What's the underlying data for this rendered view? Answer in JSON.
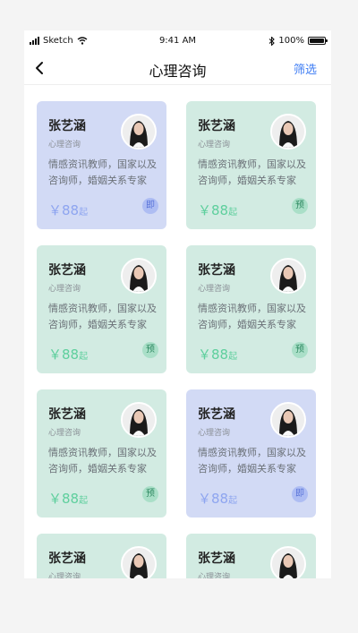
{
  "status_bar": {
    "carrier": "Sketch",
    "time": "9:41 AM",
    "battery": "100%",
    "battery_level": 1.0
  },
  "nav": {
    "title": "心理咨询",
    "filter_label": "筛选"
  },
  "cards": [
    {
      "name": "张艺涵",
      "role": "心理咨询",
      "desc": "情感资讯教师，国家以及咨询师，婚姻关系专家",
      "price": "￥88",
      "price_unit": "起",
      "badge": "即",
      "theme": "blue"
    },
    {
      "name": "张艺涵",
      "role": "心理咨询",
      "desc": "情感资讯教师，国家以及咨询师，婚姻关系专家",
      "price": "￥88",
      "price_unit": "起",
      "badge": "预",
      "theme": "teal"
    },
    {
      "name": "张艺涵",
      "role": "心理咨询",
      "desc": "情感资讯教师，国家以及咨询师，婚姻关系专家",
      "price": "￥88",
      "price_unit": "起",
      "badge": "预",
      "theme": "teal"
    },
    {
      "name": "张艺涵",
      "role": "心理咨询",
      "desc": "情感资讯教师，国家以及咨询师，婚姻关系专家",
      "price": "￥88",
      "price_unit": "起",
      "badge": "预",
      "theme": "teal"
    },
    {
      "name": "张艺涵",
      "role": "心理咨询",
      "desc": "情感资讯教师，国家以及咨询师，婚姻关系专家",
      "price": "￥88",
      "price_unit": "起",
      "badge": "预",
      "theme": "teal"
    },
    {
      "name": "张艺涵",
      "role": "心理咨询",
      "desc": "情感资讯教师，国家以及咨询师，婚姻关系专家",
      "price": "￥88",
      "price_unit": "起",
      "badge": "即",
      "theme": "blue"
    },
    {
      "name": "张艺涵",
      "role": "心理咨询",
      "desc": "",
      "price": "",
      "price_unit": "",
      "badge": "",
      "theme": "teal"
    },
    {
      "name": "张艺涵",
      "role": "心理咨询",
      "desc": "",
      "price": "",
      "price_unit": "",
      "badge": "",
      "theme": "teal"
    }
  ],
  "colors": {
    "accent": "#3d7cf4",
    "teal_card": "#d2ebe2",
    "blue_card": "#d2daf5",
    "teal_price": "#5ecf9d",
    "blue_price": "#8ea5f0"
  }
}
